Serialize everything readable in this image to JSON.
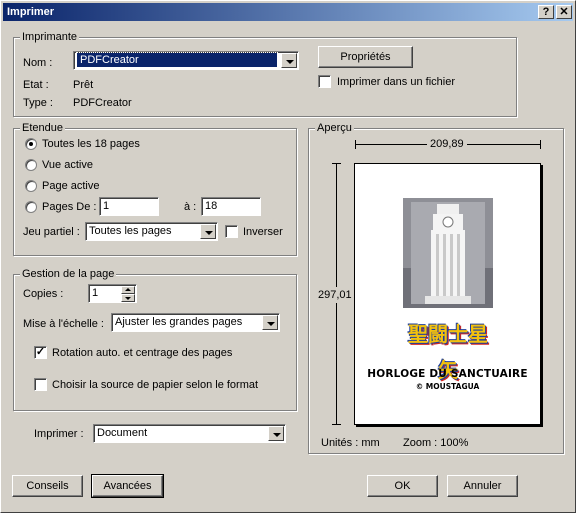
{
  "window": {
    "title": "Imprimer",
    "help_glyph": "?",
    "close_glyph": "✕"
  },
  "printer": {
    "group_label": "Imprimante",
    "name_label": "Nom :",
    "name_value": "PDFCreator",
    "state_label": "Etat :",
    "state_value": "Prêt",
    "type_label": "Type :",
    "type_value": "PDFCreator",
    "properties_button": "Propriétés",
    "print_to_file_label": "Imprimer dans un fichier",
    "print_to_file_checked": false
  },
  "range": {
    "group_label": "Etendue",
    "all_pages_label": "Toutes les 18 pages",
    "current_view_label": "Vue active",
    "current_page_label": "Page active",
    "pages_from_label": "Pages De :",
    "pages_from_value": "1",
    "pages_to_label": "à :",
    "pages_to_value": "18",
    "subset_label": "Jeu partiel :",
    "subset_value": "Toutes les pages",
    "reverse_label": "Inverser",
    "reverse_checked": false,
    "selected_option": "all_pages"
  },
  "handling": {
    "group_label": "Gestion de la page",
    "copies_label": "Copies :",
    "copies_value": "1",
    "scaling_label": "Mise à l'échelle :",
    "scaling_value": "Ajuster les grandes pages",
    "autorotate_label": "Rotation auto. et centrage des pages",
    "autorotate_checked": true,
    "paper_source_label": "Choisir la source de papier selon le format",
    "paper_source_checked": false
  },
  "print_what": {
    "label": "Imprimer :",
    "value": "Document"
  },
  "preview": {
    "group_label": "Aperçu",
    "width_value": "209,89",
    "height_value": "297,01",
    "page_title": "HORLOGE DU SANCTUAIRE",
    "page_subtitle": "© MOUSTAGUA",
    "logo_text": "聖闘士星矢",
    "units_label": "Unités : mm",
    "zoom_label": "Zoom : 100%"
  },
  "footer": {
    "tips_button": "Conseils",
    "advanced_button": "Avancées",
    "ok_button": "OK",
    "cancel_button": "Annuler"
  },
  "colors": {
    "titlebar_start": "#0a246a",
    "titlebar_end": "#a6caf0",
    "dialog_bg": "#d4d0c8",
    "logo_blue": "#1d3d9c",
    "logo_yellow": "#f3c10e",
    "logo_red": "#d8281e"
  }
}
